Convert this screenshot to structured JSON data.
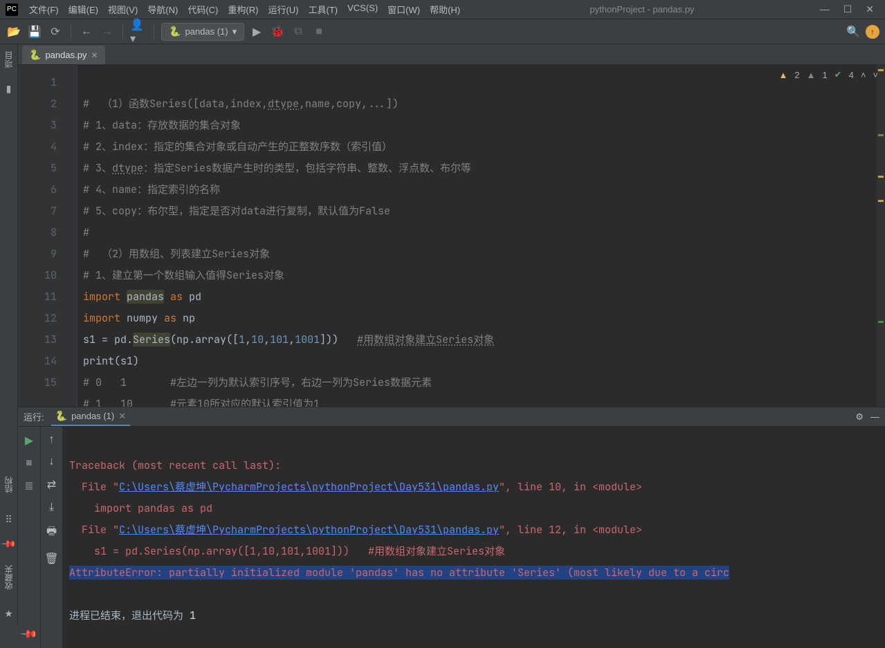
{
  "titlebar": {
    "menus": [
      "文件(F)",
      "编辑(E)",
      "视图(V)",
      "导航(N)",
      "代码(C)",
      "重构(R)",
      "运行(U)",
      "工具(T)",
      "VCS(S)",
      "窗口(W)",
      "帮助(H)"
    ],
    "title": "pythonProject - pandas.py"
  },
  "toolbar": {
    "run_config": "pandas (1)"
  },
  "tab": {
    "filename": "pandas.py"
  },
  "gutter": {
    "lines": [
      "1",
      "2",
      "3",
      "4",
      "5",
      "6",
      "7",
      "8",
      "9",
      "10",
      "11",
      "12",
      "13",
      "14",
      "15"
    ]
  },
  "code": {
    "l1_a": "#  （1）函数Series([data,index,",
    "l1_b": "dtype",
    "l1_c": ",name,copy,...])",
    "l2": "# 1、data：存放数据的集合对象",
    "l3": "# 2、index：指定的集合对象或自动产生的正整数序数（索引值）",
    "l4_a": "# 3、",
    "l4_b": "dtype",
    "l4_c": "：指定Series数据产生时的类型，包括字符串、整数、浮点数、布尔等",
    "l5": "# 4、name：指定索引的名称",
    "l6": "# 5、copy：布尔型，指定是否对data进行复制，默认值为False",
    "l7": "#",
    "l8": "#  （2）用数组、列表建立Series对象",
    "l9": "# 1、建立第一个数组输入值得Series对象",
    "l10_import": "import ",
    "l10_pandas": "pandas",
    "l10_as": " as ",
    "l10_pd": "pd",
    "l11_import": "import ",
    "l11_numpy": "numpy",
    "l11_as": " as ",
    "l11_np": "np",
    "l12_a": "s1 = pd.",
    "l12_series": "Series",
    "l12_b": "(np.array([",
    "l12_n1": "1",
    "l12_c": ",",
    "l12_n2": "10",
    "l12_c2": ",",
    "l12_n3": "101",
    "l12_c3": ",",
    "l12_n4": "1001",
    "l12_d": "]))   ",
    "l12_cm": "#用数组对象建立Series对象",
    "l13": "print(s1)",
    "l14": "# 0   1       #左边一列为默认索引序号，右边一列为Series数据元素",
    "l15": "# 1   10      #元素10所对应的默认索引值为1"
  },
  "inspections": {
    "warn": "2",
    "weak": "1",
    "ok": "4"
  },
  "run": {
    "label": "运行:",
    "tab": "pandas (1)",
    "console": {
      "l1": "Traceback (most recent call last):",
      "l2a": "  File \"",
      "l2link": "C:\\Users\\蔡虚坤\\PycharmProjects\\pythonProject\\Day531\\pandas.py",
      "l2b": "\", line 10, in <module>",
      "l3": "    import pandas as pd",
      "l4a": "  File \"",
      "l4link": "C:\\Users\\蔡虚坤\\PycharmProjects\\pythonProject\\Day531\\pandas.py",
      "l4b": "\", line 12, in <module>",
      "l5": "    s1 = pd.Series(np.array([1,10,101,1001]))   #用数组对象建立Series对象",
      "l6": "AttributeError: partially initialized module 'pandas' has no attribute 'Series' (most likely due to a circ",
      "l7": "",
      "l8a": "进程已结束，退出代码为 ",
      "l8b": "1"
    }
  },
  "rails": {
    "project": "项目",
    "structure": "结构",
    "fav": "收藏夹"
  }
}
